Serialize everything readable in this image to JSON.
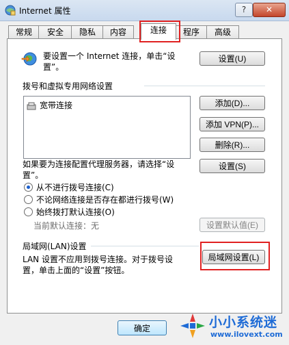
{
  "window": {
    "title": "Internet 属性",
    "help": "?",
    "close": "✕"
  },
  "tabs": [
    "常规",
    "安全",
    "隐私",
    "内容",
    "连接",
    "程序",
    "高级"
  ],
  "active_tab": "连接",
  "setup": {
    "text_line1": "要设置一个 Internet 连接，单击“设",
    "text_line2": "置”。",
    "button": "设置(U)"
  },
  "dialup": {
    "heading": "拨号和虚拟专用网络设置",
    "items": [
      "宽带连接"
    ],
    "add": "添加(D)...",
    "add_vpn": "添加 VPN(P)...",
    "remove": "删除(R)...",
    "proxy_text_line1": "如果要为连接配置代理服务器，请选择“设",
    "proxy_text_line2": "置”。",
    "settings": "设置(S)",
    "options": [
      "从不进行拨号连接(C)",
      "不论网络连接是否存在都进行拨号(W)",
      "始终拨打默认连接(O)"
    ],
    "selected_option": 0,
    "default_label": "当前默认连接：",
    "default_value": "无",
    "set_default": "设置默认值(E)"
  },
  "lan": {
    "heading": "局域网(LAN)设置",
    "text_line1": "LAN 设置不应用到拨号连接。对于拨号设",
    "text_line2": "置，单击上面的“设置”按钮。",
    "button": "局域网设置(L)"
  },
  "footer": {
    "ok": "确定"
  },
  "watermark": {
    "title": "小小系统迷",
    "url": "www.ilovext.com"
  },
  "colors": {
    "highlight": "#e02020",
    "accent": "#1b5fcc"
  }
}
